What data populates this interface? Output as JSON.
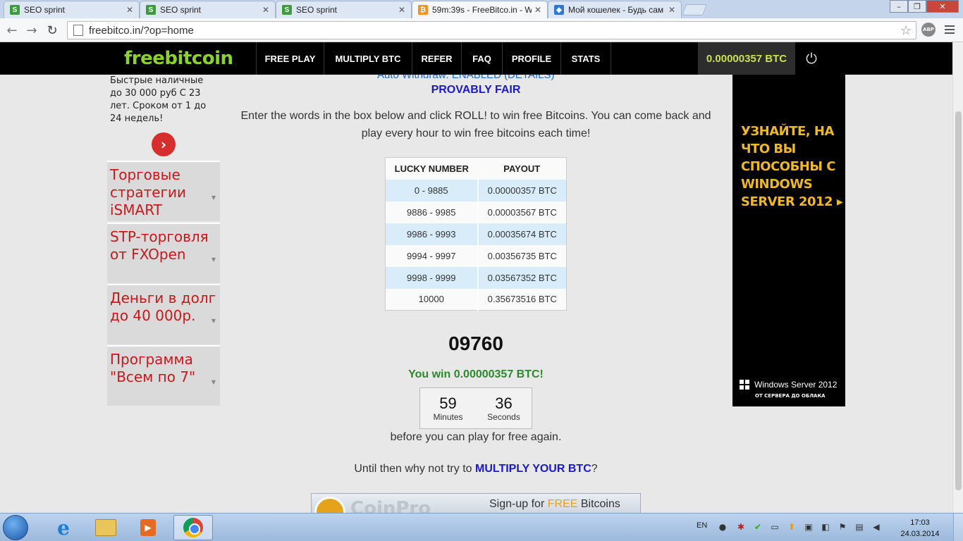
{
  "browser": {
    "tabs": [
      {
        "title": "SEO sprint",
        "favicon": "seo-sprint-icon"
      },
      {
        "title": "SEO sprint",
        "favicon": "seo-sprint-icon"
      },
      {
        "title": "SEO sprint",
        "favicon": "seo-sprint-icon"
      },
      {
        "title": "59m:39s - FreeBitco.in - W",
        "favicon": "bitcoin-icon",
        "active": true
      },
      {
        "title": "Мой кошелек - Будь сам",
        "favicon": "wallet-icon"
      }
    ],
    "url": "freebitco.in/?op=home",
    "abp_label": "ABP"
  },
  "site": {
    "logo_free": "free",
    "logo_bitcoin": "bitcoin",
    "nav": [
      "FREE PLAY",
      "MULTIPLY BTC",
      "REFER",
      "FAQ",
      "PROFILE",
      "STATS"
    ],
    "balance": "0.00000357 BTC"
  },
  "left_ad": {
    "text": "Быстрые наличные до 30 000 руб С 23 лет. Сроком от 1 до 24 недель!",
    "links": [
      "Торговые стратегии iSMART",
      "STP-торговля от FXOpen",
      "Деньги в долг до 40 000р.",
      "Программа \"Всем по 7\""
    ]
  },
  "main": {
    "auto_withdraw": "Auto Withdraw: ENABLED (DETAILS)",
    "provably_fair": "PROVABLY FAIR",
    "intro": "Enter the words in the box below and click ROLL! to win free Bitcoins. You can come back and play every hour to win free bitcoins each time!",
    "table": {
      "headers": [
        "LUCKY NUMBER",
        "PAYOUT"
      ],
      "rows": [
        [
          "0 - 9885",
          "0.00000357 BTC"
        ],
        [
          "9886 - 9985",
          "0.00003567 BTC"
        ],
        [
          "9986 - 9993",
          "0.00035674 BTC"
        ],
        [
          "9994 - 9997",
          "0.00356735 BTC"
        ],
        [
          "9998 - 9999",
          "0.03567352 BTC"
        ],
        [
          "10000",
          "0.35673516 BTC"
        ]
      ]
    },
    "lucky_number": "09760",
    "win_message": "You win 0.00000357 BTC!",
    "countdown": {
      "minutes": "59",
      "minutes_label": "Minutes",
      "seconds": "36",
      "seconds_label": "Seconds"
    },
    "before_message": "before you can play for free again.",
    "until_prefix": "Until then why not try to ",
    "until_link": "MULTIPLY YOUR BTC",
    "until_suffix": "?",
    "banner": {
      "name": "CoinPro",
      "signup_prefix": "Sign-up for ",
      "signup_free": "FREE",
      "signup_suffix": " Bitcoins"
    }
  },
  "right_ad": {
    "text": "УЗНАЙТЕ, НА ЧТО ВЫ СПОСОБНЫ С WINDOWS SERVER 2012 ▸",
    "brand": "Windows Server 2012",
    "sub": "ОТ СЕРВЕРА ДО ОБЛАКА"
  },
  "taskbar": {
    "lang": "EN",
    "time": "17:03",
    "date": "24.03.2014"
  },
  "colors": {
    "nav_bg": "#000000",
    "logo_green": "#8bd22e",
    "balance_yellow": "#c8e24a",
    "link_blue": "#1a1acc",
    "win_green": "#2b8a2b"
  }
}
